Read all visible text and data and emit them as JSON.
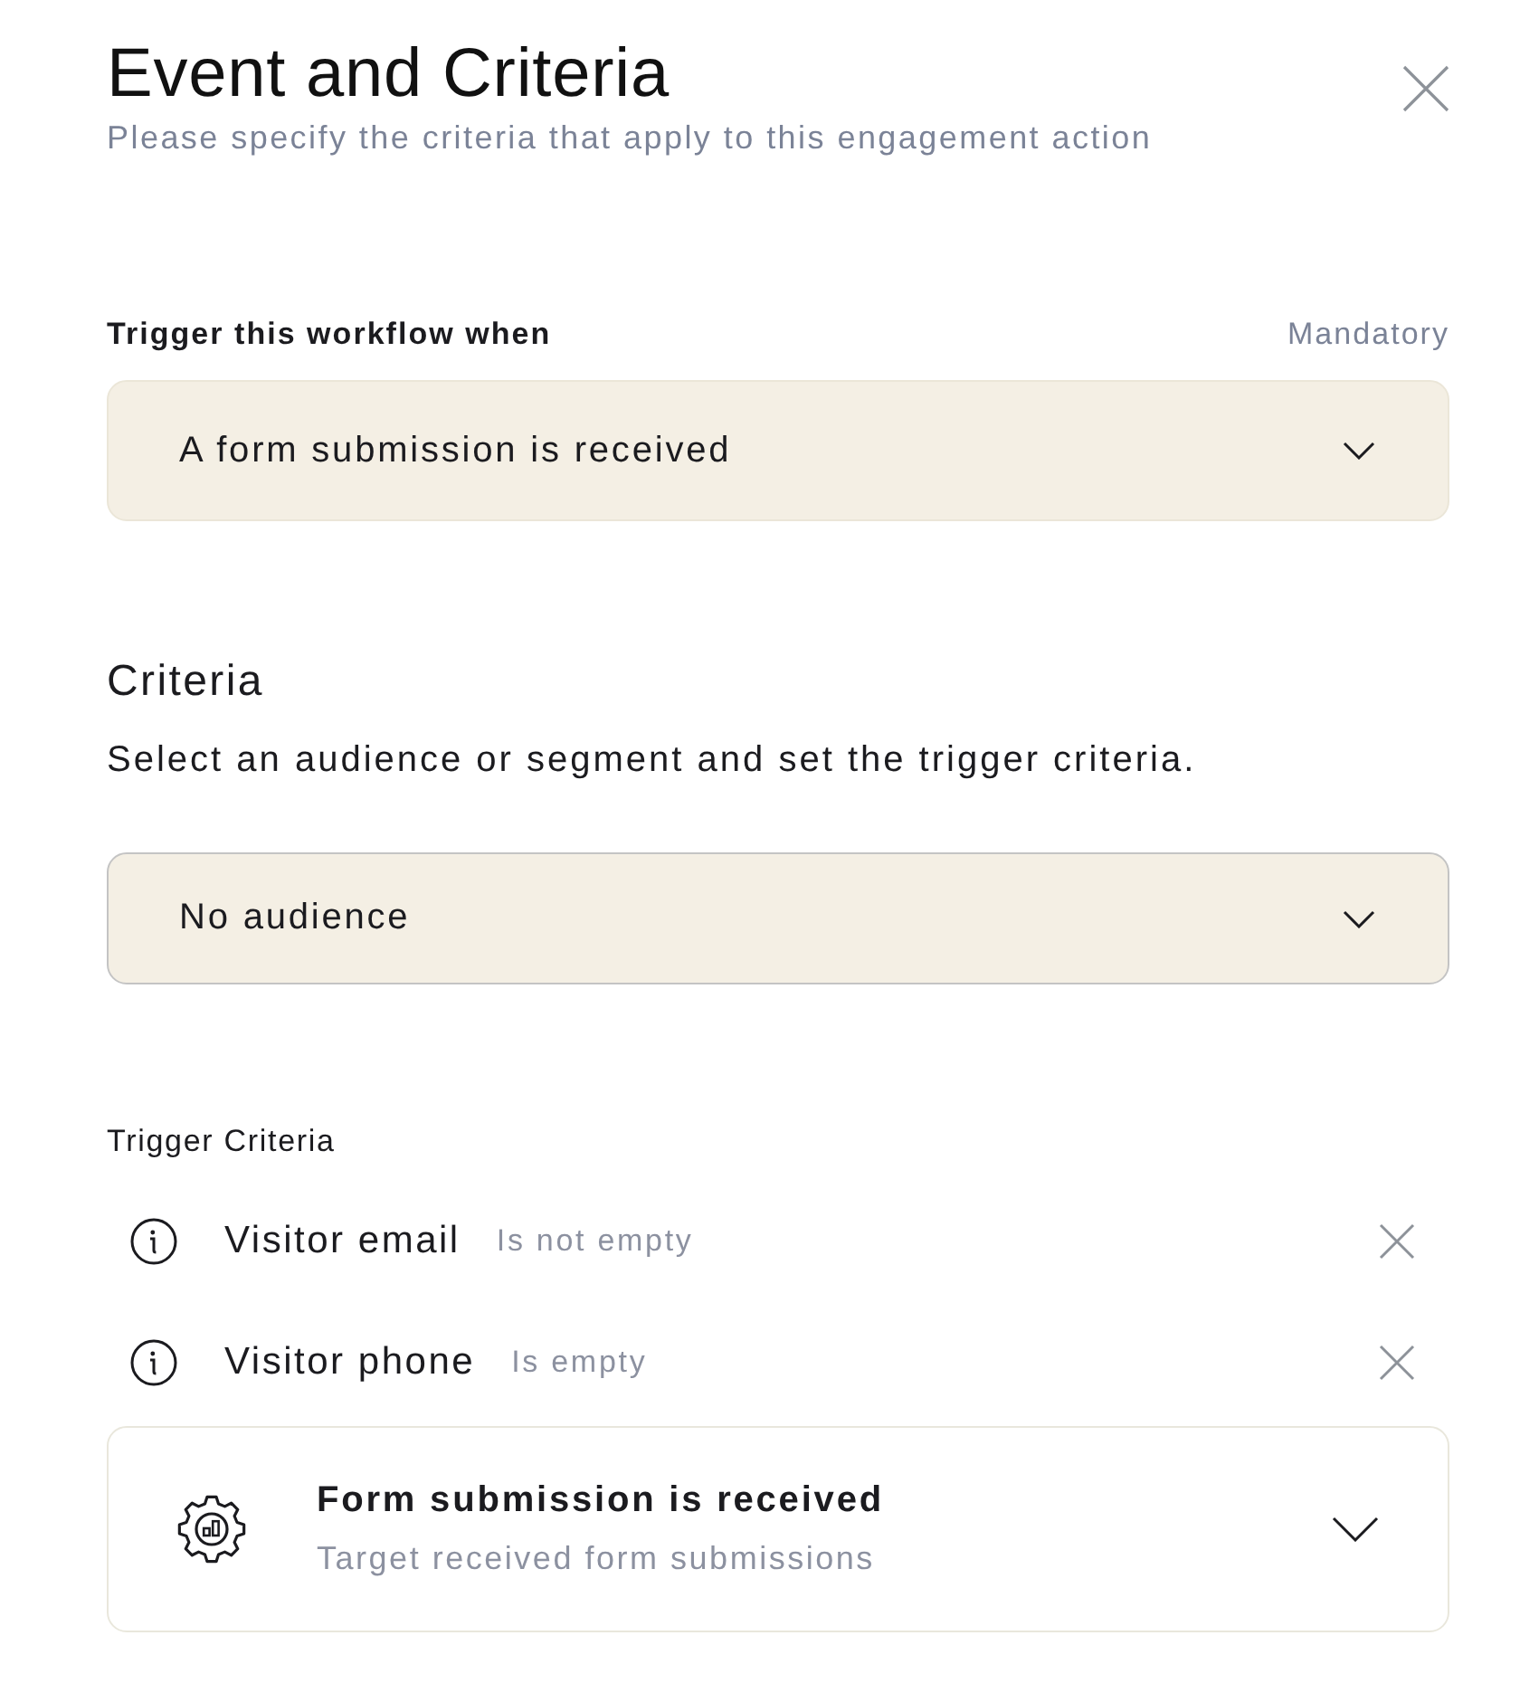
{
  "header": {
    "title": "Event and Criteria",
    "subtitle": "Please specify the criteria that apply to this engagement action"
  },
  "trigger": {
    "label": "Trigger this workflow when",
    "requirement": "Mandatory",
    "select": {
      "value": "A form submission is received"
    }
  },
  "criteria": {
    "title": "Criteria",
    "description": "Select an audience or segment and set the trigger criteria.",
    "audience_select": {
      "value": "No audience"
    }
  },
  "trigger_criteria": {
    "title": "Trigger Criteria",
    "items": [
      {
        "field": "Visitor email",
        "condition": "Is not empty"
      },
      {
        "field": "Visitor phone",
        "condition": "Is empty"
      }
    ]
  },
  "event_card": {
    "title": "Form submission is received",
    "subtitle": "Target received form submissions"
  }
}
